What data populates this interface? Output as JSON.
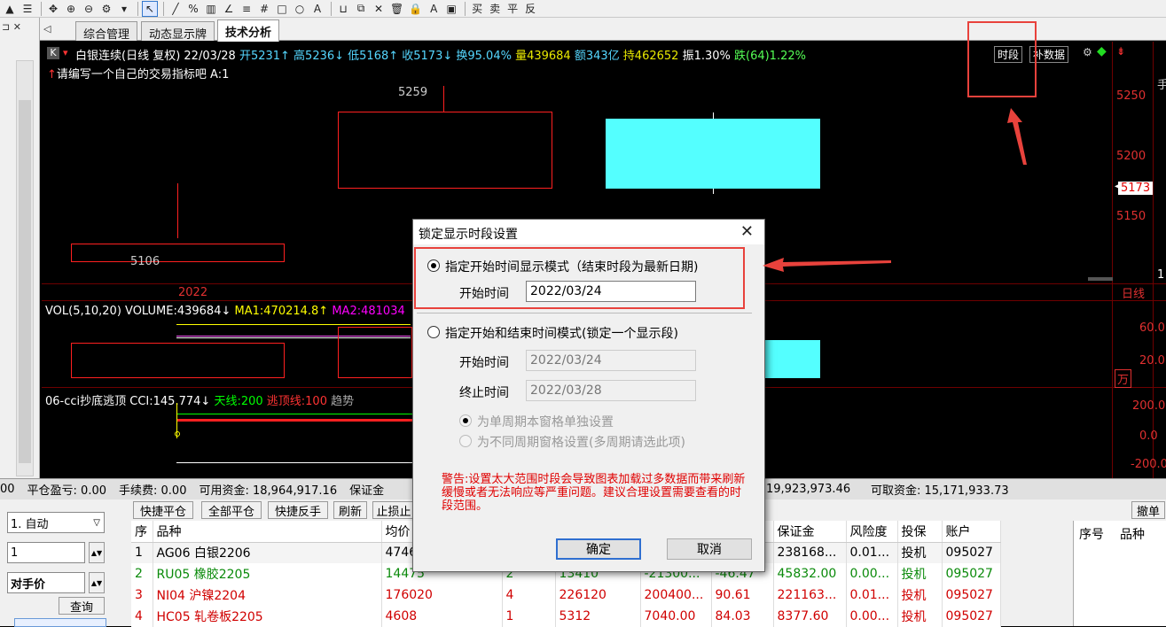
{
  "toolbar": {
    "items": [
      "▲",
      "☰",
      "✥",
      "⊕",
      "⊖",
      "⚙",
      "▾",
      "↖",
      "╱",
      "%",
      "▥",
      "∠",
      "≡",
      "#",
      "□",
      "○",
      "A",
      "⊔",
      "⧉",
      "✕",
      "🗑",
      "🔒",
      "A",
      "▣"
    ],
    "trade": [
      "买",
      "卖",
      "平",
      "反"
    ]
  },
  "tabs": [
    "综合管理",
    "动态显示牌",
    "技术分析"
  ],
  "chart": {
    "instrument_tag": "K",
    "info_segments": [
      {
        "text": "白银连续(日线 复权) 22/03/28",
        "color": "#ffffff"
      },
      {
        "text": "开5231↑",
        "color": "#55d7ff"
      },
      {
        "text": "高5236↓",
        "color": "#55d7ff"
      },
      {
        "text": "低5168↑",
        "color": "#55d7ff"
      },
      {
        "text": "收5173↓",
        "color": "#55d7ff"
      },
      {
        "text": "换95.04%",
        "color": "#55d7ff"
      },
      {
        "text": "量439684",
        "color": "#e8e800"
      },
      {
        "text": "额343亿",
        "color": "#55d7ff"
      },
      {
        "text": "持462652",
        "color": "#e8e800"
      },
      {
        "text": "振1.30%",
        "color": "#ffffff"
      },
      {
        "text": "跌(64)1.22%",
        "color": "#55ff55"
      }
    ],
    "prompt": "请编写一个自己的交易指标吧 A:1",
    "btn_shiduan": "时段",
    "btn_bushuju": "补数据",
    "label_high": "5259",
    "label_low": "5106",
    "year_label": "2022",
    "price_ticks": [
      "5250",
      "5200",
      "5150"
    ],
    "current_price": "5173",
    "period_label": "日线",
    "vol_line": [
      {
        "text": "VOL(5,10,20) VOLUME:439684↓",
        "color": "#ffffff"
      },
      {
        "text": "MA1:470214.8↑",
        "color": "#ffff00"
      },
      {
        "text": "MA2:481034",
        "color": "#ff00ff"
      }
    ],
    "vol_ticks": [
      "60.0",
      "20.0"
    ],
    "vol_unit": "万",
    "cci_line": [
      {
        "text": "06-cci抄底逃顶 CCI:145.774↓",
        "color": "#ffffff"
      },
      {
        "text": "天线:200",
        "color": "#00ff00"
      },
      {
        "text": "逃顶线:100",
        "color": "#ff3333"
      },
      {
        "text": "趋势",
        "color": "#aaaaaa"
      }
    ],
    "cci_ticks": [
      "200.0",
      "0.0",
      "-200.0"
    ],
    "colors": {
      "up": "#ff2020",
      "down": "#54ffff",
      "grid": "#6e0000"
    }
  },
  "account": {
    "items": [
      "00",
      "平仓盈亏: 0.00",
      "手续费: 0.00",
      "可用资金: 18,964,917.16",
      "保证金"
    ],
    "right_items": [
      "19,923,973.46",
      "可取资金: 15,171,933.73"
    ]
  },
  "order": {
    "mode": "1. 自动",
    "qty": "1",
    "price_type": "对手价",
    "query": "查询"
  },
  "actions": [
    "快捷平仓",
    "全部平仓",
    "快捷反手",
    "刷新",
    "止损止"
  ],
  "cancel_order": "撤单",
  "positions": {
    "headers": [
      "序",
      "品种",
      "均价",
      "",
      "",
      "",
      "",
      "",
      "保证金",
      "风险度",
      "投保",
      "账户"
    ],
    "rows": [
      [
        "1",
        "AG06 白银2206",
        "4746",
        "",
        "",
        "",
        "",
        "",
        "238168...",
        "0.01...",
        "投机",
        "095027"
      ],
      [
        "2",
        "RU05 橡胶2205",
        "14475",
        "",
        "2",
        "13410",
        "-21300...",
        "-46.47",
        "45832.00",
        "0.00...",
        "投机",
        "095027"
      ],
      [
        "3",
        "NI04 沪镍2204",
        "176020",
        "",
        "4",
        "226120",
        "200400...",
        "90.61",
        "221163...",
        "0.01...",
        "投机",
        "095027"
      ],
      [
        "4",
        "HC05 轧卷板2205",
        "4608",
        "",
        "1",
        "5312",
        "7040.00",
        "84.03",
        "8377.60",
        "0.00...",
        "投机",
        "095027"
      ]
    ]
  },
  "right_table": {
    "headers": [
      "序号",
      "品种"
    ]
  },
  "dialog": {
    "title": "锁定显示时段设置",
    "close": "✕",
    "opt1": "指定开始时间显示模式（结束时段为最新日期)",
    "opt1_start_label": "开始时间",
    "opt1_start_value": "2022/03/24",
    "opt2": "指定开始和结束时间模式(锁定一个显示段)",
    "opt2_start_label": "开始时间",
    "opt2_start_value": "2022/03/24",
    "opt2_end_label": "终止时间",
    "opt2_end_value": "2022/03/28",
    "sub1": "为单周期本窗格单独设置",
    "sub2": "为不同周期窗格设置(多周期请选此项)",
    "warning": "警告:设置太大范围时段会导致图表加载过多数据而带来刷新缓慢或者无法响应等严重问题。建议合理设置需要查看的时段范围。",
    "ok": "确定",
    "cancel": "取消"
  }
}
